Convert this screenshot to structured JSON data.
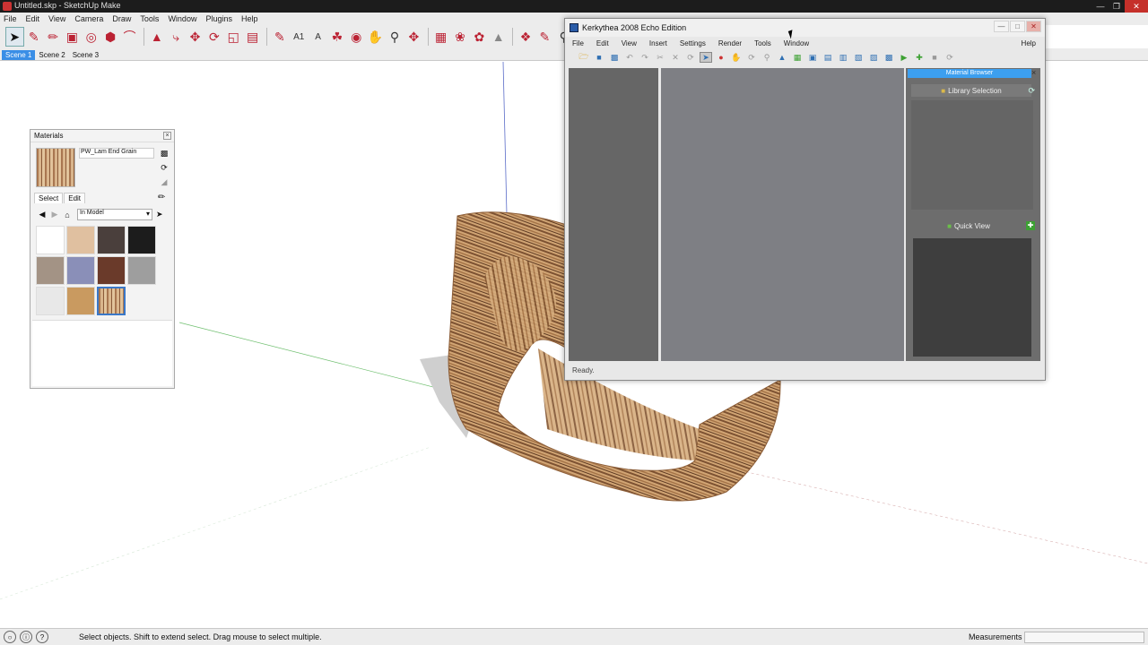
{
  "sketchup": {
    "window_title": "Untitled.skp - SketchUp Make",
    "menu": [
      "File",
      "Edit",
      "View",
      "Camera",
      "Draw",
      "Tools",
      "Window",
      "Plugins",
      "Help"
    ],
    "scenes": [
      "Scene 1",
      "Scene 2",
      "Scene 3"
    ],
    "active_scene": "Scene 1",
    "status_hint": "Select objects. Shift to extend select. Drag mouse to select multiple.",
    "measurements_label": "Measurements",
    "measurements_value": ""
  },
  "materials_panel": {
    "title": "Materials",
    "material_name": "PW_Lam End Grain",
    "tabs": [
      "Select",
      "Edit"
    ],
    "active_tab": "Select",
    "library": "In Model",
    "swatch_colors": [
      "#ffffff",
      "#e0c0a0",
      "#4a3f3c",
      "#1c1c1c",
      "#a39385",
      "#8a8fb8",
      "#6a3a2a",
      "#9e9e9e",
      "#e8e8e8",
      "#c99a60",
      "wood",
      ""
    ]
  },
  "kerkythea": {
    "window_title": "Kerkythea 2008 Echo Edition",
    "menu": [
      "File",
      "Edit",
      "View",
      "Insert",
      "Settings",
      "Render",
      "Tools",
      "Window"
    ],
    "help_menu": "Help",
    "material_browser_title": "Material Browser",
    "library_selection_label": "Library Selection",
    "quick_view_label": "Quick View",
    "status": "Ready."
  },
  "colors": {
    "scene_active": "#3a8ee6",
    "material_browser_header": "#3c9fef",
    "kt_center_panel": "#7e7f84",
    "wood_light": "#d9b58c",
    "wood_dark": "#8a5a38"
  }
}
